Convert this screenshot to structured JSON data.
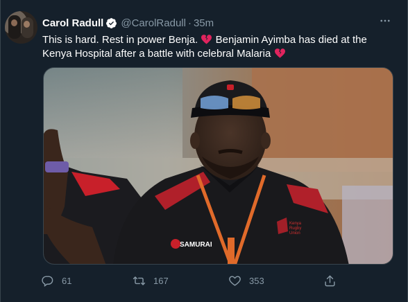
{
  "tweet": {
    "author": {
      "name": "Carol Radull",
      "handle": "@CarolRadull",
      "time": "35m",
      "separator": "·"
    },
    "text_part1": "This is hard. Rest in power Benja.",
    "text_part2": "Benjamin Ayimba has died at the Kenya Hospital after a battle with celebral Malaria",
    "emoji": "broken-heart-icon",
    "media": {
      "shirt_brand_1": "SAMURAI",
      "shirt_brand_2_line1": "Kenya",
      "shirt_brand_2_line2": "Rugby",
      "shirt_brand_2_line3": "Union"
    },
    "actions": {
      "reply_count": "61",
      "retweet_count": "167",
      "like_count": "353"
    }
  },
  "colors": {
    "background": "#15202b",
    "text_primary": "#ffffff",
    "text_secondary": "#8899a6",
    "verified": "#ffffff",
    "broken_heart": "#e0245e"
  }
}
